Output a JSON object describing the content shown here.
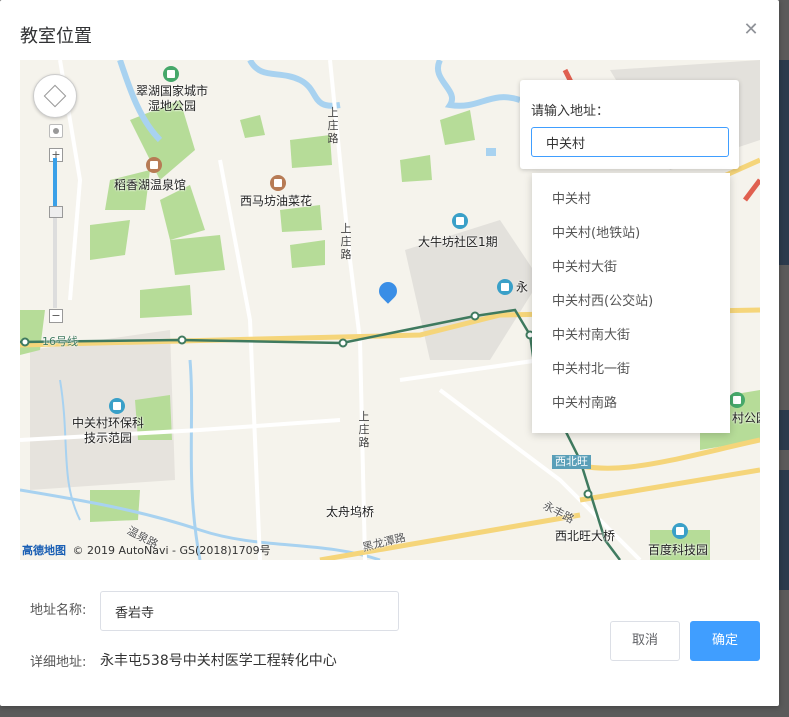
{
  "dialog": {
    "title": "教室位置",
    "close_icon": "close-icon"
  },
  "map": {
    "search": {
      "label": "请输入地址：",
      "value": "中关村"
    },
    "suggestions": [
      "中关村",
      "中关村(地铁站)",
      "中关村大街",
      "中关村西(公交站)",
      "中关村南大街",
      "中关村北一街",
      "中关村南路"
    ],
    "pois": {
      "cuihu": "翠湖国家城市湿地公园",
      "daoxiang": "稻香湖温泉馆",
      "ximafang": "西马坊油菜花",
      "daniufang": "大牛坊社区1期",
      "yong": "永",
      "zhongguancun_park": "中关村环保科技示范园",
      "taizhouwu": "太舟坞桥",
      "xibeiwang_bridge": "西北旺大桥",
      "baidu": "百度科技园",
      "cunyuan": "村公园",
      "xibeiwang_sign": "西北旺"
    },
    "roads": {
      "shangzhuang": "上庄路",
      "line16": "16号线",
      "wenquan": "温泉路",
      "heilongtan": "黑龙潭路",
      "yongfeng": "永丰路"
    },
    "attribution": {
      "brand": "高德地图",
      "copyright": "© 2019 AutoNavi - GS(2018)1709号"
    },
    "icons": {
      "pan": "pan-control-icon",
      "zoom_in": "zoom-in-icon",
      "zoom_out": "zoom-out-icon",
      "marker": "location-marker-icon"
    },
    "colors": {
      "metro": "#3f7a5f",
      "park": "#b6dc98",
      "water": "#a8d2f0",
      "main_road": "#f5d57a",
      "accent": "#409eff"
    }
  },
  "form": {
    "name_label": "地址名称:",
    "name_value": "香岩寺",
    "detail_label": "详细地址:",
    "detail_value": "永丰屯538号中关村医学工程转化中心"
  },
  "buttons": {
    "cancel": "取消",
    "confirm": "确定"
  }
}
